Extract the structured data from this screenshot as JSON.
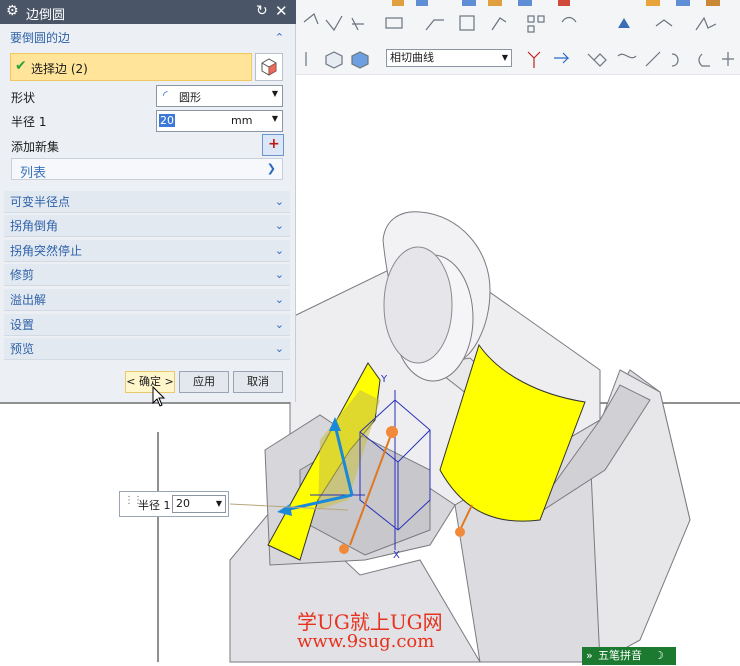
{
  "dialog": {
    "title": "边倒圆",
    "section_edges": "要倒圆的边",
    "select_edge": "选择边 (2)",
    "shape_label": "形状",
    "shape_value": "圆形",
    "radius_label": "半径 1",
    "radius_value": "20",
    "radius_unit": "mm",
    "add_set_label": "添加新集",
    "list_label": "列表",
    "collapsed_sections": [
      "可变半径点",
      "拐角倒角",
      "拐角突然停止",
      "修剪",
      "溢出解",
      "设置",
      "预览"
    ],
    "ok_label": "< 确定 >",
    "apply_label": "应用",
    "cancel_label": "取消"
  },
  "toolbar": {
    "curve_rule": "相切曲线"
  },
  "viewport": {
    "radius_callout_label": "半径 1",
    "radius_callout_value": "20",
    "triad_y": "Y",
    "triad_x": "X"
  },
  "watermark": {
    "line1": "学UG就上UG网",
    "line2": "www.9sug.com"
  },
  "ime": {
    "label": "五笔拼音"
  },
  "colors": {
    "face_yellow": "#ffff00",
    "dialog_title": "#4a5668",
    "section_blue": "#2f62a8",
    "watermark_red": "#e6321e"
  }
}
